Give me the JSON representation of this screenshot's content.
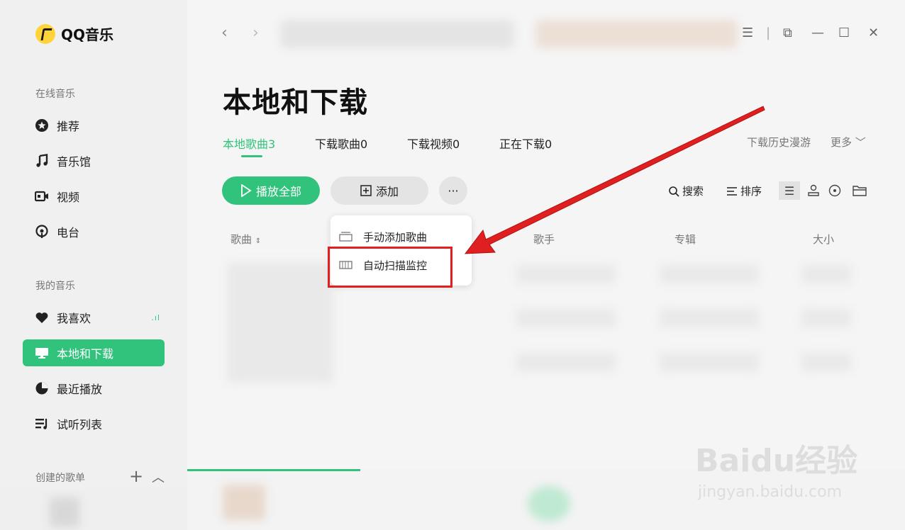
{
  "app": {
    "name": "QQ音乐"
  },
  "sidebar": {
    "online_label": "在线音乐",
    "online_items": [
      {
        "label": "推荐",
        "icon": "star-icon"
      },
      {
        "label": "音乐馆",
        "icon": "music-note-icon"
      },
      {
        "label": "视频",
        "icon": "video-icon"
      },
      {
        "label": "电台",
        "icon": "radio-icon"
      }
    ],
    "my_label": "我的音乐",
    "my_items": [
      {
        "label": "我喜欢",
        "icon": "heart-icon"
      },
      {
        "label": "本地和下载",
        "icon": "monitor-icon",
        "active": true
      },
      {
        "label": "最近播放",
        "icon": "clock-icon"
      },
      {
        "label": "试听列表",
        "icon": "playlist-icon"
      }
    ],
    "created_label": "创建的歌单"
  },
  "page": {
    "title": "本地和下载",
    "tabs": [
      "本地歌曲3",
      "下载歌曲0",
      "下载视频0",
      "正在下载0"
    ],
    "right_links": {
      "history": "下载历史漫游",
      "more": "更多"
    }
  },
  "actions": {
    "play_all": "播放全部",
    "add": "添加",
    "more": "···"
  },
  "tools": {
    "search": "搜索",
    "sort": "排序"
  },
  "columns": {
    "song": "歌曲",
    "artist": "歌手",
    "album": "专辑",
    "size": "大小"
  },
  "menu": {
    "items": [
      "手动添加歌曲",
      "自动扫描监控"
    ]
  },
  "watermark": {
    "brand": "Baidu经验",
    "url": "jingyan.baidu.com"
  },
  "colors": {
    "accent": "#31c27c",
    "highlight": "#e02020"
  }
}
